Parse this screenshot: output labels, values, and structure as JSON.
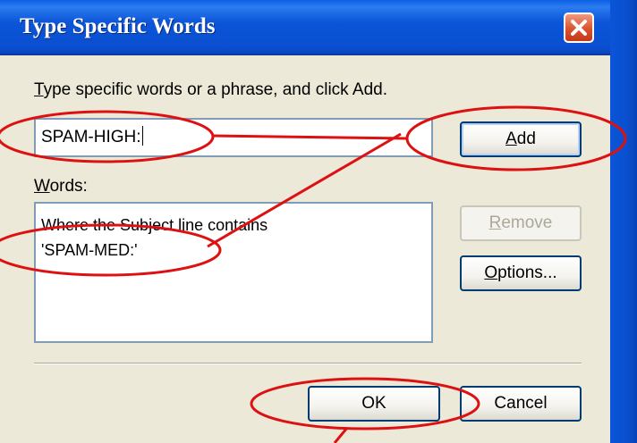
{
  "dialog": {
    "title": "Type Specific Words",
    "instruction_prefix": "T",
    "instruction_rest": "ype specific words or a phrase, and click Add.",
    "input_value": "SPAM-HIGH:",
    "words_label_prefix": "W",
    "words_label_rest": "ords:",
    "list_lines": [
      "Where the Subject line contains",
      "'SPAM-MED:'"
    ],
    "buttons": {
      "add_prefix": "A",
      "add_rest": "dd",
      "remove_prefix": "R",
      "remove_rest": "emove",
      "options_prefix": "O",
      "options_rest": "ptions...",
      "ok": "OK",
      "cancel": "Cancel"
    }
  },
  "annotation_color": "#dd1111",
  "icons": {
    "close": "close-icon"
  }
}
